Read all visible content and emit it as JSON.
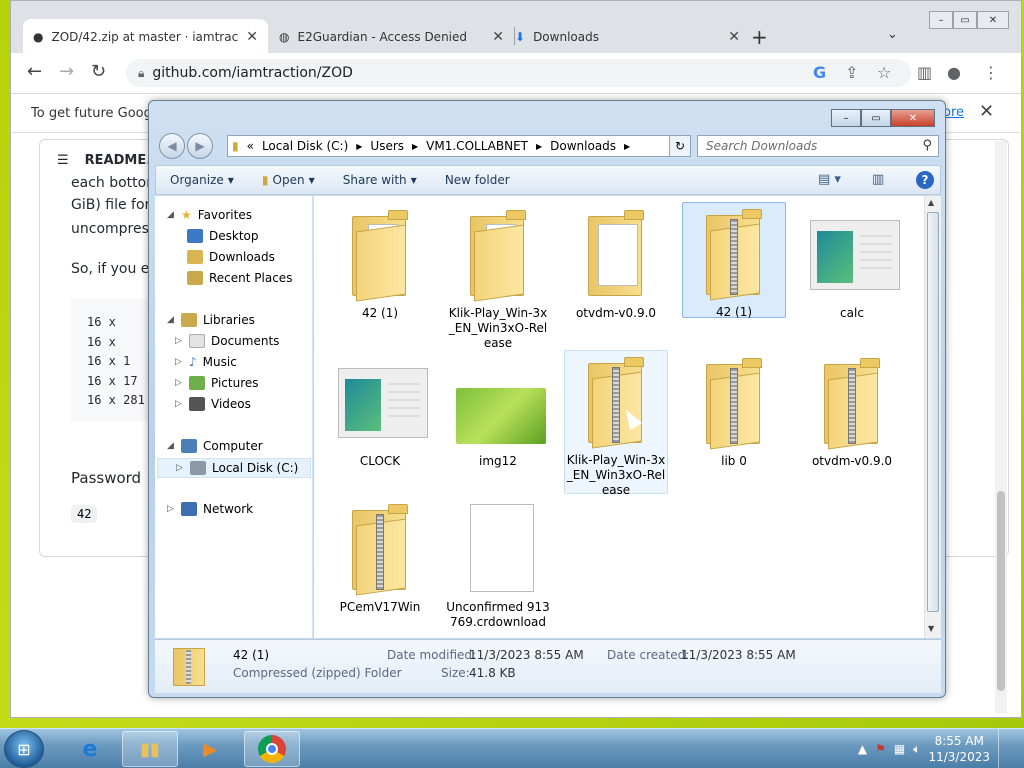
{
  "browser": {
    "tabs": [
      {
        "title": "ZOD/42.zip at master · iamtraction",
        "icon": "github-icon"
      },
      {
        "title": "E2Guardian - Access Denied",
        "icon": "globe-icon"
      },
      {
        "title": "Downloads",
        "icon": "download-icon"
      }
    ],
    "url": "github.com/iamtraction/ZOD",
    "infobar_text": "To get future Google",
    "infobar_link": "ore",
    "readme_title": "README.",
    "readme_lines": [
      "each bottom",
      "GiB) file for",
      "uncompres",
      "So, if you e"
    ],
    "code_lines": [
      "16 x",
      "16 x",
      "16 x   1",
      "16 x  17",
      "16 x 281"
    ],
    "password_label": "Password",
    "password_value": "42"
  },
  "explorer": {
    "breadcrumb": [
      "«",
      "Local Disk (C:)",
      "Users",
      "VM1.COLLABNET",
      "Downloads"
    ],
    "search_placeholder": "Search Downloads",
    "commands": [
      "Organize",
      "Open",
      "Share with",
      "New folder"
    ],
    "nav": {
      "favorites": "Favorites",
      "desktop": "Desktop",
      "downloads": "Downloads",
      "recent": "Recent Places",
      "libraries": "Libraries",
      "documents": "Documents",
      "music": "Music",
      "pictures": "Pictures",
      "videos": "Videos",
      "computer": "Computer",
      "localdisk": "Local Disk (C:)",
      "network": "Network"
    },
    "files": [
      {
        "name": "42 (1)",
        "kind": "folder"
      },
      {
        "name": "Klik-Play_Win-3x_EN_Win3xO-Release",
        "kind": "folder"
      },
      {
        "name": "otvdm-v0.9.0",
        "kind": "folder-paper"
      },
      {
        "name": "42 (1)",
        "kind": "zip",
        "selected": true
      },
      {
        "name": "calc",
        "kind": "app"
      },
      {
        "name": "CLOCK",
        "kind": "app"
      },
      {
        "name": "img12",
        "kind": "image"
      },
      {
        "name": "Klik-Play_Win-3x_EN_Win3xO-Release",
        "kind": "zip",
        "hover": true
      },
      {
        "name": "lib 0",
        "kind": "zip"
      },
      {
        "name": "otvdm-v0.9.0",
        "kind": "zip"
      },
      {
        "name": "PCemV17Win",
        "kind": "zip"
      },
      {
        "name": "Unconfirmed 913769.crdownload",
        "kind": "doc"
      }
    ],
    "details": {
      "name": "42 (1)",
      "type": "Compressed (zipped) Folder",
      "modified_label": "Date modified:",
      "modified": "11/3/2023 8:55 AM",
      "created_label": "Date created:",
      "created": "11/3/2023 8:55 AM",
      "size_label": "Size:",
      "size": "41.8 KB"
    }
  },
  "taskbar": {
    "time": "8:55 AM",
    "date": "11/3/2023"
  }
}
